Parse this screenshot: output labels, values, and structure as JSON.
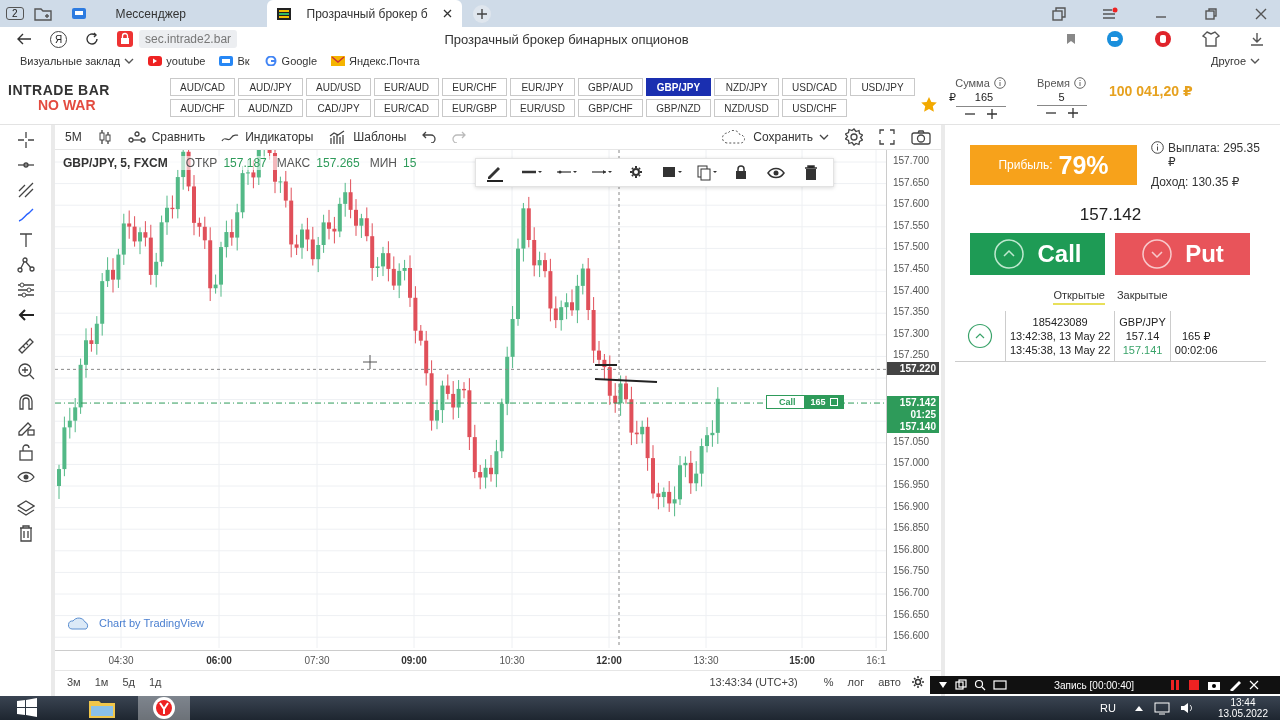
{
  "browser": {
    "tab_count": "2",
    "tabs": [
      {
        "title": "Мессенджер",
        "selected": false
      },
      {
        "title": "Прозрачный брокер б",
        "selected": true
      }
    ],
    "search_button": "Я",
    "address": "sec.intrade2.bar",
    "page_title": "Прозрачный брокер бинарных опционов",
    "bookmarks": [
      "Визуальные заклад",
      "youtube",
      "Вк",
      "Google",
      "Яндекс.Почта"
    ],
    "other_bookmarks": "Другое"
  },
  "header": {
    "logo": [
      "INTRADE BAR",
      "NO WAR"
    ],
    "pair_rows": [
      [
        {
          "label": "AUD/CAD",
          "selected": false
        },
        {
          "label": "AUD/JPY",
          "selected": false
        },
        {
          "label": "AUD/USD",
          "selected": false
        },
        {
          "label": "EUR/AUD",
          "selected": false
        },
        {
          "label": "EUR/CHF",
          "selected": false
        },
        {
          "label": "EUR/JPY",
          "selected": false
        },
        {
          "label": "GBP/AUD",
          "selected": false
        },
        {
          "label": "GBP/JPY",
          "selected": true
        },
        {
          "label": "NZD/JPY",
          "selected": false
        },
        {
          "label": "USD/CAD",
          "selected": false
        },
        {
          "label": "USD/JPY",
          "selected": false
        }
      ],
      [
        {
          "label": "AUD/CHF",
          "selected": false
        },
        {
          "label": "AUD/NZD",
          "selected": false
        },
        {
          "label": "CAD/JPY",
          "selected": false
        },
        {
          "label": "EUR/CAD",
          "selected": false
        },
        {
          "label": "EUR/GBP",
          "selected": false
        },
        {
          "label": "EUR/USD",
          "selected": false
        },
        {
          "label": "GBP/CHF",
          "selected": false
        },
        {
          "label": "GBP/NZD",
          "selected": false
        },
        {
          "label": "NZD/USD",
          "selected": false
        },
        {
          "label": "USD/CHF",
          "selected": false
        }
      ]
    ],
    "amount": {
      "label": "Сумма",
      "currency": "₽",
      "value": "165"
    },
    "time": {
      "label": "Время",
      "value": "5"
    },
    "balance": "100 041,20 ₽"
  },
  "chart_toolbar": {
    "interval": "5М",
    "items": [
      "Сравнить",
      "Индикаторы",
      "Шаблоны"
    ],
    "save": "Сохранить"
  },
  "chart": {
    "legend": {
      "symbol": "GBP/JPY, 5, FXCM",
      "fields": [
        {
          "label": "ОТКР",
          "value": "157.187"
        },
        {
          "label": "МАКС",
          "value": "157.265"
        },
        {
          "label": "МИН",
          "value": "15"
        }
      ]
    },
    "price_ticks_upper": [
      "157.700",
      "157.650",
      "157.600",
      "157.550",
      "157.500",
      "157.450",
      "157.400",
      "157.350",
      "157.300",
      "157.250"
    ],
    "price_ticks_lower": [
      "157.050",
      "157.000",
      "156.950",
      "156.900",
      "156.850",
      "156.800",
      "156.750",
      "156.700",
      "156.650",
      "156.600"
    ],
    "time_ticks": [
      {
        "label": "04:30",
        "major": false
      },
      {
        "label": "06:00",
        "major": true
      },
      {
        "label": "07:30",
        "major": false
      },
      {
        "label": "09:00",
        "major": true
      },
      {
        "label": "10:30",
        "major": false
      },
      {
        "label": "12:00",
        "major": true
      },
      {
        "label": "13:30",
        "major": false
      },
      {
        "label": "15:00",
        "major": true
      },
      {
        "label": "16:1",
        "major": false
      }
    ],
    "markers": [
      {
        "kind": "crosshair",
        "label": "157.220"
      },
      {
        "kind": "current",
        "label": "157.142"
      },
      {
        "kind": "countdown",
        "label": "01:25"
      },
      {
        "kind": "bid",
        "label": "157.140"
      }
    ],
    "order": {
      "direction": "Call",
      "amount": "165"
    },
    "attribution": "Chart by TradingView"
  },
  "chart_footer": {
    "ranges": [
      "3м",
      "1м",
      "5д",
      "1д"
    ],
    "clock": "13:43:34 (UTC+3)",
    "options": [
      "%",
      "лог",
      "авто"
    ]
  },
  "trade_panel": {
    "profit_label": "Прибыль:",
    "profit": "79%",
    "payout": "Выплата: 295.35 ₽",
    "income": "Доход: 130.35 ₽",
    "price": "157.142",
    "call": "Call",
    "put": "Put",
    "tabs": [
      {
        "label": "Открытые",
        "selected": true
      },
      {
        "label": "Закрытые",
        "selected": false
      }
    ],
    "trades": [
      {
        "id": "185423089",
        "opened": "13:42:38, 13 May 22",
        "closes": "13:45:38, 13 May 22",
        "pair": "GBP/JPY",
        "open_price": "157.14",
        "current_price": "157.141",
        "amount": "165 ₽",
        "remaining": "00:02:06"
      }
    ]
  },
  "recorder": "Запись [00:00:40]",
  "taskbar": {
    "language": "RU",
    "time": "13:44",
    "date": "13.05.2022"
  }
}
